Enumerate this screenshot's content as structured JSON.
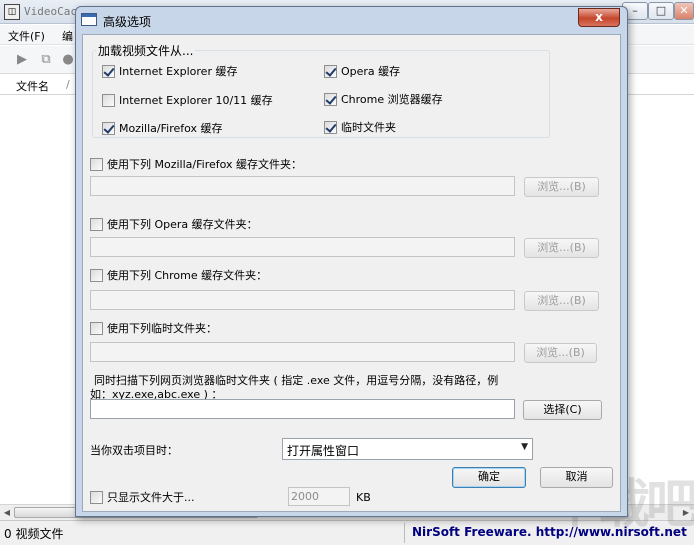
{
  "main": {
    "title": "VideoCac",
    "menu": {
      "file": "文件(F)",
      "edit": "编"
    },
    "column_filename": "文件名",
    "column_sep": "/",
    "status_count": "0 视频文件",
    "status_link": "NirSoft Freeware.  http://www.nirsoft.net",
    "watermark": "下载吧"
  },
  "dialog": {
    "title": "高级选项",
    "close_label": "x",
    "group_label": "加载视频文件从...",
    "sources": [
      {
        "label": "Internet Explorer 缓存",
        "checked": true
      },
      {
        "label": "Opera 缓存",
        "checked": true
      },
      {
        "label": "Internet Explorer 10/11 缓存",
        "checked": false
      },
      {
        "label": "Chrome 浏览器缓存",
        "checked": true
      },
      {
        "label": "Mozilla/Firefox 缓存",
        "checked": true
      },
      {
        "label": "临时文件夹",
        "checked": true
      }
    ],
    "folders": [
      {
        "label": "使用下列 Mozilla/Firefox 缓存文件夹：",
        "checked": false,
        "value": "",
        "browse": "浏览...(B)"
      },
      {
        "label": "使用下列 Opera 缓存文件夹：",
        "checked": false,
        "value": "",
        "browse": "浏览...(B)"
      },
      {
        "label": "使用下列 Chrome 缓存文件夹：",
        "checked": false,
        "value": "",
        "browse": "浏览...(B)"
      },
      {
        "label": "使用下列临时文件夹：",
        "checked": false,
        "value": "",
        "browse": "浏览...(B)"
      }
    ],
    "scan_label_line1": "同时扫描下列网页浏览器临时文件夹 ( 指定 .exe 文件，用逗号分隔，没有路径，例",
    "scan_label_line2": "如：xyz.exe,abc.exe ) ：",
    "scan_value": "",
    "select_button": "选择(C)",
    "doubleclick_label": "当你双击项目时：",
    "doubleclick_value": "打开属性窗口",
    "ok_button": "确定",
    "cancel_button": "取消",
    "size_filter_label": "只显示文件大于...",
    "size_filter_checked": false,
    "size_value": "2000",
    "size_unit": "KB"
  }
}
